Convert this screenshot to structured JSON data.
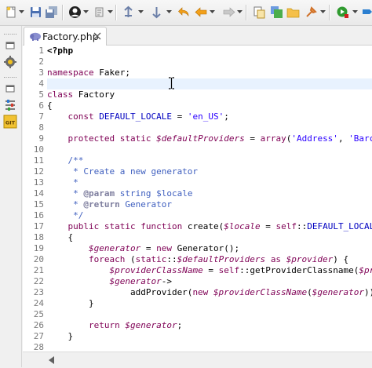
{
  "toolbar": {
    "buttons": [
      {
        "name": "new-icon"
      },
      {
        "name": "save-icon"
      },
      {
        "name": "save-all-icon"
      },
      {
        "name": "user-icon"
      },
      {
        "name": "debug-icon"
      },
      {
        "name": "run-icon"
      },
      {
        "name": "back-icon"
      },
      {
        "name": "forward-icon"
      },
      {
        "name": "history-icon"
      },
      {
        "name": "open-type-icon"
      },
      {
        "name": "open-resource-icon"
      },
      {
        "name": "open-folder-icon"
      },
      {
        "name": "pin-icon"
      },
      {
        "name": "external-tools-icon"
      }
    ]
  },
  "trim": {
    "icons": [
      {
        "name": "minimized-view-icon"
      },
      {
        "name": "package-explorer-icon"
      },
      {
        "name": "minimized-view-icon"
      },
      {
        "name": "outline-icon"
      },
      {
        "name": "git-icon"
      }
    ],
    "git_label": "GIT"
  },
  "editor_tab": {
    "title": "Factory.php",
    "icon": "php-elephant-icon",
    "close_icon": "close-icon"
  },
  "editor": {
    "current_line": 4,
    "lines": [
      {
        "n": "1",
        "tokens": [
          [
            "t-php",
            "<?php"
          ]
        ]
      },
      {
        "n": "2",
        "tokens": []
      },
      {
        "n": "3",
        "tokens": [
          [
            "t-kw",
            "namespace"
          ],
          [
            "t-txt",
            " Faker;"
          ]
        ]
      },
      {
        "n": "4",
        "tokens": []
      },
      {
        "n": "5",
        "tokens": [
          [
            "t-kw",
            "class"
          ],
          [
            "t-txt",
            " Factory"
          ]
        ]
      },
      {
        "n": "6",
        "tokens": [
          [
            "t-txt",
            "{"
          ]
        ]
      },
      {
        "n": "7",
        "tokens": [
          [
            "t-txt",
            "    "
          ],
          [
            "t-kw",
            "const"
          ],
          [
            "t-txt",
            " "
          ],
          [
            "t-const",
            "DEFAULT_LOCALE"
          ],
          [
            "t-txt",
            " = "
          ],
          [
            "t-str",
            "'en_US'"
          ],
          [
            "t-txt",
            ";"
          ]
        ]
      },
      {
        "n": "8",
        "tokens": []
      },
      {
        "n": "9",
        "tokens": [
          [
            "t-txt",
            "    "
          ],
          [
            "t-kw",
            "protected"
          ],
          [
            "t-txt",
            " "
          ],
          [
            "t-kw",
            "static"
          ],
          [
            "t-txt",
            " "
          ],
          [
            "t-var",
            "$defaultProviders"
          ],
          [
            "t-txt",
            " = "
          ],
          [
            "t-kw",
            "array"
          ],
          [
            "t-txt",
            "("
          ],
          [
            "t-str",
            "'Address'"
          ],
          [
            "t-txt",
            ", "
          ],
          [
            "t-str",
            "'Barc"
          ]
        ]
      },
      {
        "n": "10",
        "tokens": []
      },
      {
        "n": "11",
        "tokens": [
          [
            "t-cmt",
            "    /**"
          ]
        ]
      },
      {
        "n": "12",
        "tokens": [
          [
            "t-cmt",
            "     * Create a new generator"
          ]
        ]
      },
      {
        "n": "13",
        "tokens": [
          [
            "t-cmt",
            "     *"
          ]
        ]
      },
      {
        "n": "14",
        "tokens": [
          [
            "t-cmt",
            "     * "
          ],
          [
            "t-tag",
            "@param"
          ],
          [
            "t-cmt",
            " string $locale"
          ]
        ]
      },
      {
        "n": "15",
        "tokens": [
          [
            "t-cmt",
            "     * "
          ],
          [
            "t-tag",
            "@return"
          ],
          [
            "t-cmt",
            " Generator"
          ]
        ]
      },
      {
        "n": "16",
        "tokens": [
          [
            "t-cmt",
            "     */"
          ]
        ]
      },
      {
        "n": "17",
        "tokens": [
          [
            "t-txt",
            "    "
          ],
          [
            "t-kw",
            "public"
          ],
          [
            "t-txt",
            " "
          ],
          [
            "t-kw",
            "static"
          ],
          [
            "t-txt",
            " "
          ],
          [
            "t-kw",
            "function"
          ],
          [
            "t-txt",
            " create("
          ],
          [
            "t-var",
            "$locale"
          ],
          [
            "t-txt",
            " = "
          ],
          [
            "t-kw",
            "self"
          ],
          [
            "t-txt",
            "::"
          ],
          [
            "t-const",
            "DEFAULT_LOCAL"
          ]
        ]
      },
      {
        "n": "18",
        "tokens": [
          [
            "t-txt",
            "    {"
          ]
        ]
      },
      {
        "n": "19",
        "tokens": [
          [
            "t-txt",
            "        "
          ],
          [
            "t-var",
            "$generator"
          ],
          [
            "t-txt",
            " = "
          ],
          [
            "t-kw",
            "new"
          ],
          [
            "t-txt",
            " Generator();"
          ]
        ]
      },
      {
        "n": "20",
        "tokens": [
          [
            "t-txt",
            "        "
          ],
          [
            "t-kw",
            "foreach"
          ],
          [
            "t-txt",
            " ("
          ],
          [
            "t-kw",
            "static"
          ],
          [
            "t-txt",
            "::"
          ],
          [
            "t-var",
            "$defaultProviders"
          ],
          [
            "t-txt",
            " "
          ],
          [
            "t-kw",
            "as"
          ],
          [
            "t-txt",
            " "
          ],
          [
            "t-var",
            "$provider"
          ],
          [
            "t-txt",
            ") {"
          ]
        ]
      },
      {
        "n": "21",
        "tokens": [
          [
            "t-txt",
            "            "
          ],
          [
            "t-var",
            "$providerClassName"
          ],
          [
            "t-txt",
            " = "
          ],
          [
            "t-kw",
            "self"
          ],
          [
            "t-txt",
            "::getProviderClassname("
          ],
          [
            "t-var",
            "$pr"
          ]
        ]
      },
      {
        "n": "22",
        "tokens": [
          [
            "t-txt",
            "            "
          ],
          [
            "t-var",
            "$generator"
          ],
          [
            "t-txt",
            "->"
          ]
        ]
      },
      {
        "n": "23",
        "tokens": [
          [
            "t-txt",
            "                addProvider("
          ],
          [
            "t-kw",
            "new"
          ],
          [
            "t-txt",
            " "
          ],
          [
            "t-var",
            "$providerClassName"
          ],
          [
            "t-txt",
            "("
          ],
          [
            "t-var",
            "$generator"
          ],
          [
            "t-txt",
            "))"
          ]
        ]
      },
      {
        "n": "24",
        "tokens": [
          [
            "t-txt",
            "        }"
          ]
        ]
      },
      {
        "n": "25",
        "tokens": []
      },
      {
        "n": "26",
        "tokens": [
          [
            "t-txt",
            "        "
          ],
          [
            "t-kw",
            "return"
          ],
          [
            "t-txt",
            " "
          ],
          [
            "t-var",
            "$generator"
          ],
          [
            "t-txt",
            ";"
          ]
        ]
      },
      {
        "n": "27",
        "tokens": [
          [
            "t-txt",
            "    }"
          ]
        ]
      },
      {
        "n": "28",
        "tokens": []
      }
    ]
  },
  "scrollbar": {
    "left_arrow": "scroll-left-icon"
  },
  "colors": {
    "keyword": "#7f0055",
    "constant": "#0000c0",
    "string": "#2a00ff",
    "comment": "#3f5fbf",
    "line_number": "#787878",
    "current_line": "#e8f2fe"
  }
}
